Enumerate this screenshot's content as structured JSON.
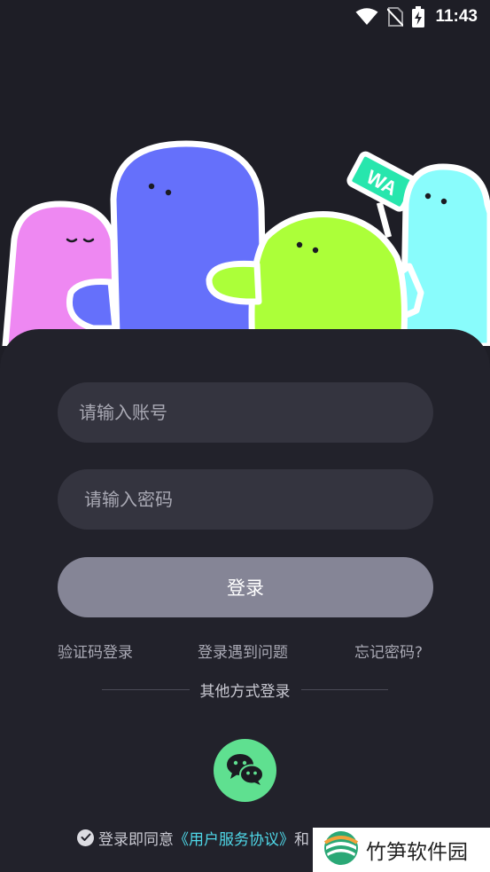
{
  "status_bar": {
    "time": "11:43",
    "icons": [
      "wifi-icon",
      "no-sim-icon",
      "battery-charging-icon"
    ]
  },
  "illustration": {
    "sign_text": "WA",
    "colors": {
      "pink": "#ee88f2",
      "blue": "#6570fb",
      "green": "#acff39",
      "cyan": "#89fcfc",
      "sign": "#27e6ad",
      "outline": "#ffffff"
    }
  },
  "login_form": {
    "account_placeholder": "请输入账号",
    "password_placeholder": "请输入密码",
    "login_button": "登录"
  },
  "links": {
    "sms_login": "验证码登录",
    "login_problem": "登录遇到问题",
    "forgot_password": "忘记密码?"
  },
  "other_methods": {
    "label": "其他方式登录",
    "wechat_icon": "wechat-icon",
    "wechat_color": "#5fe090"
  },
  "agreement": {
    "prefix": "登录即同意",
    "link": "《用户服务协议》",
    "suffix": "和"
  },
  "watermark": {
    "text": "竹笋软件园"
  },
  "colors": {
    "background": "#1e1e26",
    "card": "#22222b",
    "input": "#34343f",
    "button": "#858596",
    "accent_link": "#4fd8e8"
  }
}
